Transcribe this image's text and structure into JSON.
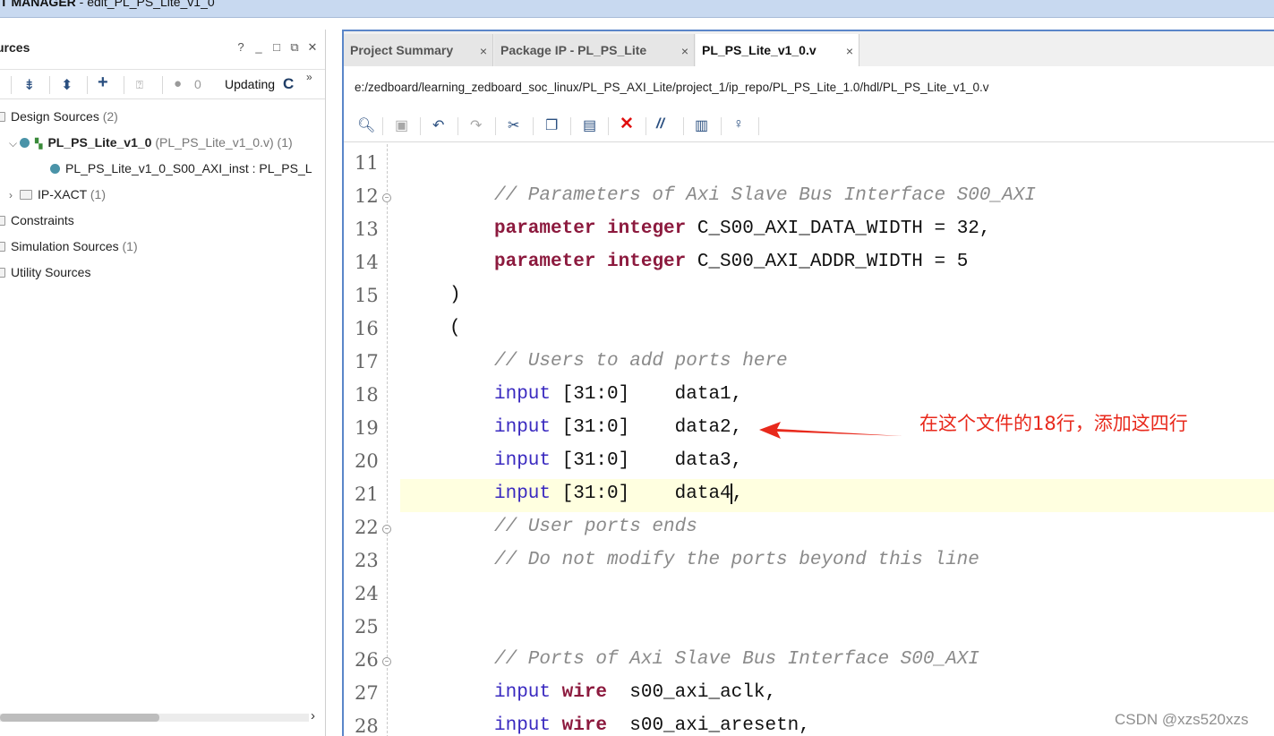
{
  "window": {
    "title_bold": "T MANAGER",
    "title_rest": " - edit_PL_PS_Lite_v1_0"
  },
  "sources_panel": {
    "title": "urces",
    "window_buttons": [
      "?",
      "_",
      "□",
      "⧉",
      "✕"
    ],
    "toolbar": {
      "count": "0",
      "status": "Updating",
      "refresh": "C",
      "more": "»"
    },
    "tree": [
      {
        "label": "Design Sources",
        "count": "(2)"
      },
      {
        "label": "PL_PS_Lite_v1_0",
        "detail": "(PL_PS_Lite_v1_0.v)",
        "count": "(1)"
      },
      {
        "label": "PL_PS_Lite_v1_0_S00_AXI_inst : PL_PS_L"
      },
      {
        "label": "IP-XACT",
        "count": "(1)"
      },
      {
        "label": "Constraints"
      },
      {
        "label": "Simulation Sources",
        "count": "(1)"
      },
      {
        "label": "Utility Sources"
      }
    ]
  },
  "editor": {
    "tabs": [
      {
        "label": "Project Summary",
        "close": "×"
      },
      {
        "label": "Package IP - PL_PS_Lite",
        "close": "×"
      },
      {
        "label": "PL_PS_Lite_v1_0.v",
        "close": "×",
        "active": true
      }
    ],
    "file_path": "e:/zedboard/learning_zedboard_soc_linux/PL_PS_AXI_Lite/project_1/ip_repo/PL_PS_Lite_1.0/hdl/PL_PS_Lite_v1_0.v",
    "lines": [
      {
        "n": "11"
      },
      {
        "n": "12",
        "comment": "// Parameters of Axi Slave Bus Interface S00_AXI"
      },
      {
        "n": "13",
        "kw": "parameter",
        "kw2": "integer",
        "rest": " C_S00_AXI_DATA_WIDTH = 32,"
      },
      {
        "n": "14",
        "kw": "parameter",
        "kw2": "integer",
        "rest": " C_S00_AXI_ADDR_WIDTH = 5"
      },
      {
        "n": "15",
        "text": ")"
      },
      {
        "n": "16",
        "text": "("
      },
      {
        "n": "17",
        "comment": "// Users to add ports here"
      },
      {
        "n": "18",
        "kw": "input",
        "rest": " [31:0]    data1,"
      },
      {
        "n": "19",
        "kw": "input",
        "rest": " [31:0]    data2,"
      },
      {
        "n": "20",
        "kw": "input",
        "rest": " [31:0]    data3,"
      },
      {
        "n": "21",
        "kw": "input",
        "rest": " [31:0]    data4",
        "after_caret": ","
      },
      {
        "n": "22",
        "comment": "// User ports ends"
      },
      {
        "n": "23",
        "comment": "// Do not modify the ports beyond this line"
      },
      {
        "n": "24"
      },
      {
        "n": "25"
      },
      {
        "n": "26",
        "comment": "// Ports of Axi Slave Bus Interface S00_AXI"
      },
      {
        "n": "27",
        "kw": "input",
        "kw3": "wire",
        "rest": "  s00_axi_aclk,"
      },
      {
        "n": "28",
        "kw": "input",
        "kw3": "wire",
        "rest": "  s00_axi_aresetn,"
      }
    ]
  },
  "annotation": "在这个文件的18行，添加这四行",
  "watermark": "CSDN @xzs520xzs",
  "colors": {
    "annotation": "#e8291c",
    "editor_border": "#5a86c9",
    "current_line": "#ffffe0"
  }
}
